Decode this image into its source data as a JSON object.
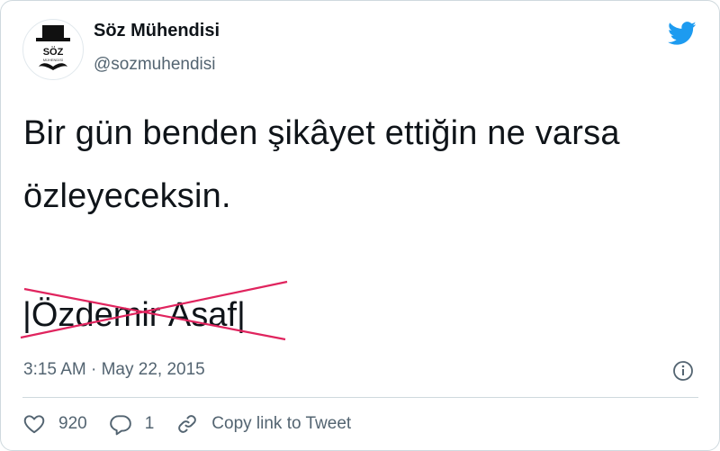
{
  "author": {
    "name": "Söz Mühendisi",
    "handle": "@sozmuhendisi",
    "avatar_text": "SÖZ",
    "avatar_subtext": "MÜHENDİSİ"
  },
  "tweet": {
    "text": "Bir gün benden şikâyet ettiğin ne varsa özleyeceksin.",
    "signature": "|Özdemir Asaf|",
    "time": "3:15 AM",
    "separator": "·",
    "date": "May 22, 2015"
  },
  "actions": {
    "likes": "920",
    "replies": "1",
    "copy_link": "Copy link to Tweet"
  },
  "colors": {
    "brand": "#1d9bf0",
    "text": "#0f1419",
    "secondary": "#536471",
    "strike": "#e0245e"
  },
  "icons": {
    "logo": "twitter-bird-icon",
    "info": "info-icon",
    "like": "heart-icon",
    "reply": "reply-bubble-icon",
    "link": "link-icon"
  }
}
